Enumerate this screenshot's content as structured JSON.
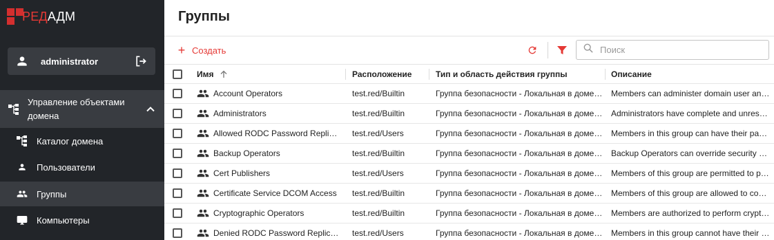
{
  "app": {
    "logo_red": "РЕД",
    "logo_white": "АДМ",
    "brand_color": "#d32f2f"
  },
  "user": {
    "name": "administrator",
    "avatar_icon": "person-icon",
    "logout_icon": "logout-icon"
  },
  "sidebar": {
    "group": {
      "label_line1": "Управление объектами",
      "label_line2": "домена",
      "icon": "domain-tree-icon",
      "expanded": true
    },
    "items": [
      {
        "label": "Каталог домена",
        "icon": "domain-tree-icon",
        "active": false
      },
      {
        "label": "Пользователи",
        "icon": "person-icon",
        "active": false
      },
      {
        "label": "Группы",
        "icon": "group-icon",
        "active": true
      },
      {
        "label": "Компьютеры",
        "icon": "monitor-icon",
        "active": false
      }
    ]
  },
  "page": {
    "title": "Группы"
  },
  "toolbar": {
    "create_label": "Создать",
    "search_placeholder": "Поиск",
    "accent": "#e53935"
  },
  "table": {
    "columns": [
      "Имя",
      "Расположение",
      "Тип и область действия группы",
      "Описание"
    ],
    "sort_column": "Имя",
    "sort_direction": "asc",
    "rows": [
      {
        "name": "Account Operators",
        "location": "test.red/Builtin",
        "type": "Группа безопасности - Локальная в домене",
        "description": "Members can administer domain user and g..."
      },
      {
        "name": "Administrators",
        "location": "test.red/Builtin",
        "type": "Группа безопасности - Локальная в домене",
        "description": "Administrators have complete and unrestrict..."
      },
      {
        "name": "Allowed RODC Password Replicatio...",
        "location": "test.red/Users",
        "type": "Группа безопасности - Локальная в домене",
        "description": "Members in this group can have their passw..."
      },
      {
        "name": "Backup Operators",
        "location": "test.red/Builtin",
        "type": "Группа безопасности - Локальная в домене",
        "description": "Backup Operators can override security restr..."
      },
      {
        "name": "Cert Publishers",
        "location": "test.red/Users",
        "type": "Группа безопасности - Локальная в домене",
        "description": "Members of this group are permitted to publi..."
      },
      {
        "name": "Certificate Service DCOM Access",
        "location": "test.red/Builtin",
        "type": "Группа безопасности - Локальная в домене",
        "description": "Members of this group are allowed to conne..."
      },
      {
        "name": "Cryptographic Operators",
        "location": "test.red/Builtin",
        "type": "Группа безопасности - Локальная в домене",
        "description": "Members are authorized to perform cryptogr..."
      },
      {
        "name": "Denied RODC Password Replication...",
        "location": "test.red/Users",
        "type": "Группа безопасности - Локальная в домене",
        "description": "Members in this group cannot have their pas..."
      }
    ]
  }
}
